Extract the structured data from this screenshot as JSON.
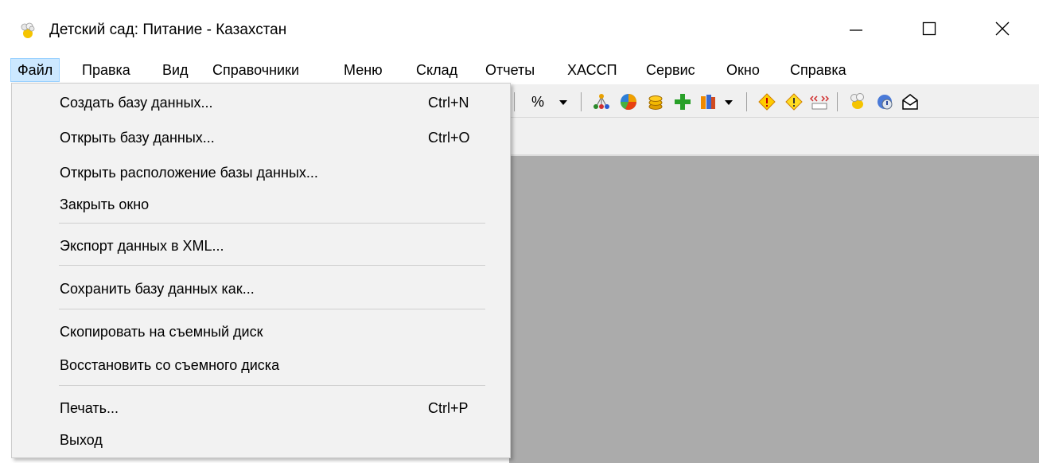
{
  "window": {
    "title": "Детский сад: Питание - Казахстан",
    "icons": {
      "app": "chef-hat-icon",
      "minimize": "minimize-icon",
      "maximize": "maximize-icon",
      "close": "close-icon"
    }
  },
  "menubar": {
    "items": [
      "Файл",
      "Правка",
      "Вид",
      "Справочники",
      "Меню",
      "Склад",
      "Отчеты",
      "ХАССП",
      "Сервис",
      "Окно",
      "Справка"
    ],
    "active": "Файл"
  },
  "file_menu": {
    "items": [
      {
        "label": "Создать базу данных...",
        "shortcut": "Ctrl+N"
      },
      {
        "label": "Открыть базу данных...",
        "shortcut": "Ctrl+O"
      },
      {
        "label": "Открыть расположение базы данных...",
        "shortcut": ""
      },
      {
        "label": "Закрыть окно",
        "shortcut": ""
      },
      {
        "label": "Экспорт данных в XML...",
        "shortcut": ""
      },
      {
        "label": "Сохранить базу данных как...",
        "shortcut": ""
      },
      {
        "label": "Скопировать на съемный диск",
        "shortcut": ""
      },
      {
        "label": "Восстановить со съемного диска",
        "shortcut": ""
      },
      {
        "label": "Печать...",
        "shortcut": "Ctrl+P"
      },
      {
        "label": "Выход",
        "shortcut": ""
      }
    ]
  },
  "toolbar": {
    "percent_label": "%",
    "icons": [
      "percent-dropdown-icon",
      "hierarchy-icon",
      "pie-chart-icon",
      "coins-icon",
      "green-plus-icon",
      "books-icon",
      "books-dropdown-icon",
      "warning-diamond-icon",
      "warning-diamond-2-icon",
      "abc-icon",
      "chef-icon",
      "help-globe-icon",
      "envelope-icon"
    ]
  },
  "colors": {
    "menu_active_bg": "#cce8ff",
    "dropdown_bg": "#f2f2f2",
    "workspace_bg": "#ababab"
  }
}
